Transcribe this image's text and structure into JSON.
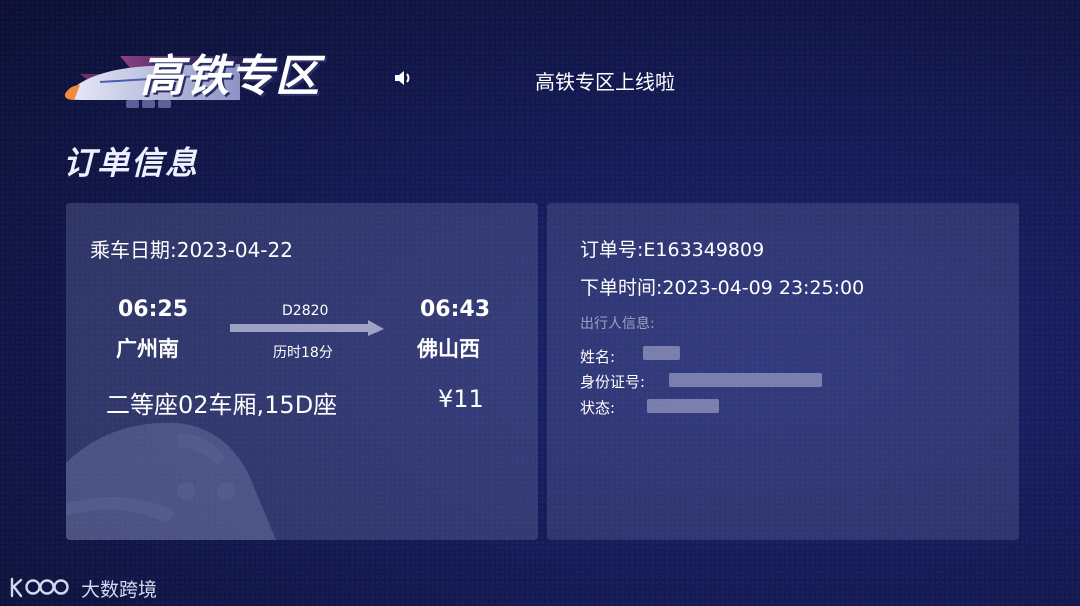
{
  "header": {
    "logo_title": "高铁专区",
    "speaker_icon": "speaker-icon",
    "marquee_text": "高铁专区上线啦"
  },
  "section_title": "订单信息",
  "ticket": {
    "ride_date": "乘车日期:2023-04-22",
    "departure_time": "06:25",
    "departure_station": "广州南",
    "train_number": "D2820",
    "duration": "历时18分",
    "arrival_time": "06:43",
    "arrival_station": "佛山西",
    "seat": "二等座02车厢,15D座",
    "price": "¥11"
  },
  "order": {
    "order_number": "订单号:E163349809",
    "order_time": "下单时间:2023-04-09 23:25:00",
    "traveler_title": "出行人信息:",
    "name_label": "姓名:",
    "id_label": "身份证号:",
    "status_label": "状态:"
  },
  "footer": {
    "brand_text": "大数跨境"
  },
  "colors": {
    "background": "#151b57",
    "card": "#4b5281",
    "muted_text": "#9aa0c4",
    "accent_orange": "#f08a3c"
  }
}
